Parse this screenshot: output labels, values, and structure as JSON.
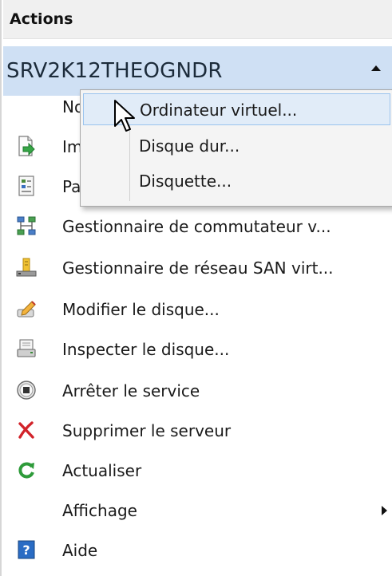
{
  "panel": {
    "title": "Actions"
  },
  "server": {
    "name": "SRV2K12THEOGNDR"
  },
  "menu": [
    {
      "label": "No",
      "icon": "none"
    },
    {
      "label": "Im",
      "icon": "import-icon"
    },
    {
      "label": "Pa",
      "icon": "settings-icon"
    },
    {
      "label": "Gestionnaire de commutateur v...",
      "icon": "switch-manager-icon"
    },
    {
      "label": "Gestionnaire de réseau SAN virt...",
      "icon": "san-manager-icon"
    },
    {
      "label": "Modifier le disque...",
      "icon": "edit-disk-icon"
    },
    {
      "label": "Inspecter le disque...",
      "icon": "inspect-disk-icon"
    },
    {
      "label": "Arrêter le service",
      "icon": "stop-service-icon"
    },
    {
      "label": "Supprimer le serveur",
      "icon": "remove-server-icon"
    },
    {
      "label": "Actualiser",
      "icon": "refresh-icon"
    },
    {
      "label": "Affichage",
      "icon": "none"
    },
    {
      "label": "Aide",
      "icon": "help-icon"
    }
  ],
  "submenu": [
    {
      "label": "Ordinateur virtuel..."
    },
    {
      "label": "Disque dur..."
    },
    {
      "label": "Disquette..."
    }
  ],
  "colors": {
    "selection": "#cfe0f4",
    "hover": "#e1ecf8",
    "remove_red": "#d2232a",
    "refresh_green": "#2e9b3a",
    "help_blue": "#2a6cc4"
  }
}
